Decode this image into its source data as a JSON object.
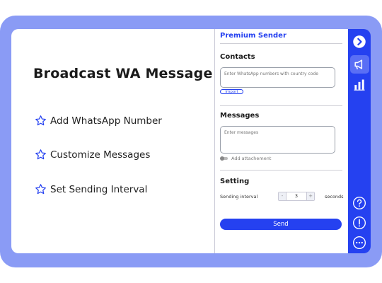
{
  "headline": "Broadcast WA Message",
  "features": [
    {
      "icon": "star-outline-icon",
      "label": "Add WhatsApp Number"
    },
    {
      "icon": "star-outline-icon",
      "label": "Customize Messages"
    },
    {
      "icon": "star-outline-icon",
      "label": "Set Sending Interval"
    }
  ],
  "panel": {
    "title": "Premium Sender",
    "contacts": {
      "title": "Contacts",
      "placeholder": "Enter WhatsApp numbers with country code",
      "import_label": "Import"
    },
    "messages": {
      "title": "Messages",
      "placeholder": "Enter messages",
      "attachment_label": "Add attachement"
    },
    "setting": {
      "title": "Setting",
      "interval_label": "Sending interval",
      "interval_value": "3",
      "decrement": "-",
      "increment": "+",
      "unit": "seconds"
    },
    "send_label": "Send"
  },
  "rail_icons": [
    "chevron-right-icon",
    "megaphone-icon",
    "bar-chart-icon",
    "help-icon",
    "info-icon",
    "more-icon"
  ],
  "colors": {
    "accent": "#2541f0",
    "frame": "#8a9bf5"
  }
}
